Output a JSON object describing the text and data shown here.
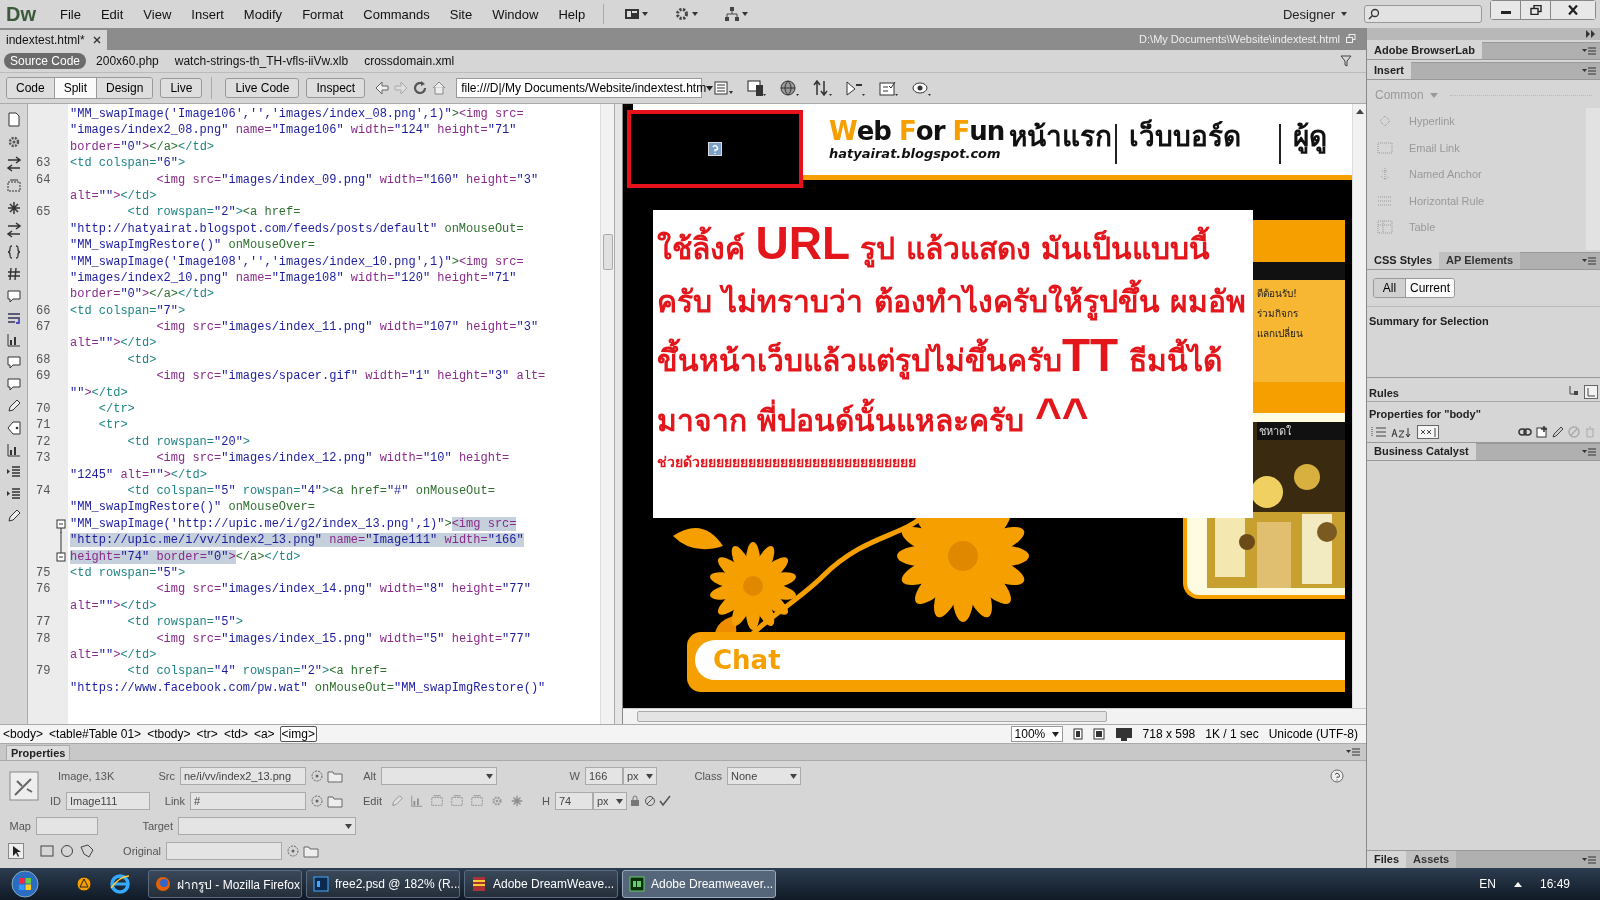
{
  "app": {
    "logo": "Dw",
    "menus": [
      "File",
      "Edit",
      "View",
      "Insert",
      "Modify",
      "Format",
      "Commands",
      "Site",
      "Window",
      "Help"
    ],
    "workspace": "Designer"
  },
  "document_tabs": [
    {
      "label": "indextest.html*",
      "selected": true
    }
  ],
  "document_path": "D:\\My Documents\\Website\\indextest.html",
  "related_files": [
    {
      "label": "Source Code",
      "selected": true
    },
    {
      "label": "200x60.php",
      "selected": false
    },
    {
      "label": "watch-strings-th_TH-vfls-iiVw.xlb",
      "selected": false
    },
    {
      "label": "crossdomain.xml",
      "selected": false
    }
  ],
  "toolbar": {
    "view_buttons": [
      {
        "label": "Code",
        "selected": false
      },
      {
        "label": "Split",
        "selected": true
      },
      {
        "label": "Design",
        "selected": false
      },
      {
        "label": "Live",
        "selected": false
      }
    ],
    "live_buttons": [
      "Live Code",
      "Inspect"
    ],
    "address": "file:///D|/My Documents/Website/indextest.htm"
  },
  "code_lines": [
    {
      "text": "\"MM_swapImage('Image106','','images/index_08.png',1)\"><img src="
    },
    {
      "text": "\"images/index2_08.png\" name=\"Image106\" width=\"124\" height=\"71\""
    },
    {
      "text": "border=\"0\"></a></td>"
    },
    {
      "number": "63",
      "text": "<td colspan=\"6\">"
    },
    {
      "number": "64",
      "text": "            <img src=\"images/index_09.png\" width=\"160\" height=\"3\""
    },
    {
      "text": "alt=\"\"></td>"
    },
    {
      "number": "65",
      "text": "        <td rowspan=\"2\"><a href="
    },
    {
      "text": "\"http://hatyairat.blogspot.com/feeds/posts/default\" onMouseOut="
    },
    {
      "text": "\"MM_swapImgRestore()\" onMouseOver="
    },
    {
      "text": "\"MM_swapImage('Image108','','images/index_10.png',1)\"><img src="
    },
    {
      "text": "\"images/index2_10.png\" name=\"Image108\" width=\"120\" height=\"71\""
    },
    {
      "text": "border=\"0\"></a></td>"
    },
    {
      "number": "66",
      "text": "<td colspan=\"7\">"
    },
    {
      "number": "67",
      "text": "            <img src=\"images/index_11.png\" width=\"107\" height=\"3\""
    },
    {
      "text": "alt=\"\"></td>"
    },
    {
      "number": "68",
      "text": "        <td>"
    },
    {
      "number": "69",
      "text": "            <img src=\"images/spacer.gif\" width=\"1\" height=\"3\" alt="
    },
    {
      "text": "\"\"></td>"
    },
    {
      "number": "70",
      "text": "    </tr>"
    },
    {
      "number": "71",
      "text": "    <tr>"
    },
    {
      "number": "72",
      "text": "        <td rowspan=\"20\">"
    },
    {
      "number": "73",
      "text": "            <img src=\"images/index_12.png\" width=\"10\" height="
    },
    {
      "text": "\"1245\" alt=\"\"></td>"
    },
    {
      "number": "74",
      "text": "        <td colspan=\"5\" rowspan=\"4\"><a href=\"#\" onMouseOut="
    },
    {
      "text": "\"MM_swapImgRestore()\" onMouseOver="
    },
    {
      "kind": "fold-start",
      "parts": [
        {
          "text": "\"MM_swapImage('http://upic.me/i/g2/index_13.png',1)\">",
          "selected": false
        },
        {
          "text": "<img src=",
          "selected": true
        }
      ]
    },
    {
      "kind": "fold-middle",
      "parts": [
        {
          "text": "\"http://upic.me/i/vv/index2_13.png\" name=\"Image111\" width=\"166\"",
          "selected": true
        }
      ]
    },
    {
      "kind": "fold-end",
      "parts": [
        {
          "text": "height=\"74\" border=\"0\">",
          "selected": true
        },
        {
          "text": "</a></td>",
          "selected": false
        }
      ]
    },
    {
      "number": "75",
      "text": "<td rowspan=\"5\">"
    },
    {
      "number": "76",
      "text": "            <img src=\"images/index_14.png\" width=\"8\" height=\"77\""
    },
    {
      "text": "alt=\"\"></td>"
    },
    {
      "number": "77",
      "text": "        <td rowspan=\"5\">"
    },
    {
      "number": "78",
      "text": "            <img src=\"images/index_15.png\" width=\"5\" height=\"77\""
    },
    {
      "text": "alt=\"\"></td>"
    },
    {
      "number": "79",
      "text": "        <td colspan=\"4\" rowspan=\"2\"><a href="
    },
    {
      "text": "\"https://www.facebook.com/pw.wat\" onMouseOut=\"MM_swapImgRestore()\""
    }
  ],
  "design_view": {
    "logo_title": "Web For Fun",
    "logo_url": "hatyairat.blogspot.com",
    "nav_items": [
      "หน้าแรก",
      "เว็บบอร์ด",
      "ผู้ดู"
    ],
    "message": "ใช้ลิ้งค์ **URL** รูป แล้วแสดง มันเป็นแบบนี้ครับ ไม่ทราบว่า ต้องทำไงครับให้รูปขึ้น ผมอัพขึ้นหน้าเว็บแล้วแต่รูปไม่ขึ้นครับ**TT** ธีมนี้ได้ มาจาก พี่ปอนด์นั้นแหละครับ **^^**",
    "message_note": "ช่วยด้วยยยยยยยยยยยยยยยยยยยยยยยยยยย",
    "side_texts": [
      "ดีต้อนรับ!",
      "ร่วมกิจกร",
      "แลกเปลี่ยน"
    ],
    "photo_caption": "ชหาดใ",
    "chat_title": "Chat"
  },
  "status_bar": {
    "tags": [
      {
        "label": "<body>",
        "selected": false
      },
      {
        "label": "<table#Table 01>",
        "selected": false
      },
      {
        "label": "<tbody>",
        "selected": false
      },
      {
        "label": "<tr>",
        "selected": false
      },
      {
        "label": "<td>",
        "selected": false
      },
      {
        "label": "<a>",
        "selected": false
      },
      {
        "label": "<img>",
        "selected": true
      }
    ],
    "zoom": "100%",
    "size": "718 x 598",
    "download": "1K / 1 sec",
    "encoding": "Unicode (UTF-8)"
  },
  "properties": {
    "title": "Properties",
    "type_label": "Image, 13K",
    "id_label": "ID",
    "id_value": "Image111",
    "src_label": "Src",
    "src_value": "ne/i/vv/index2_13.png",
    "link_label": "Link",
    "link_value": "#",
    "alt_label": "Alt",
    "edit_label": "Edit",
    "w_label": "W",
    "w_value": "166",
    "w_unit": "px",
    "h_label": "H",
    "h_value": "74",
    "h_unit": "px",
    "class_label": "Class",
    "class_value": "None",
    "map_label": "Map",
    "target_label": "Target",
    "original_label": "Original"
  },
  "panels": {
    "browserlab": "Adobe BrowserLab",
    "insert_tab": "Insert",
    "insert_category": "Common",
    "insert_items": [
      {
        "label": "Hyperlink",
        "disabled": true
      },
      {
        "label": "Email Link",
        "disabled": true
      },
      {
        "label": "Named Anchor",
        "disabled": true
      },
      {
        "label": "Horizontal Rule",
        "disabled": true
      },
      {
        "label": "Table",
        "disabled": true
      }
    ],
    "css_tabs": [
      {
        "label": "CSS Styles",
        "selected": true
      },
      {
        "label": "AP Elements",
        "selected": false
      }
    ],
    "css_modes": [
      {
        "label": "All",
        "selected": false
      },
      {
        "label": "Current",
        "selected": true
      }
    ],
    "summary_title": "Summary for Selection",
    "rules_title": "Rules",
    "properties_title": "Properties for \"body\"",
    "business_catalyst": "Business Catalyst",
    "bottom_tabs": [
      {
        "label": "Files",
        "selected": true
      },
      {
        "label": "Assets",
        "selected": false
      }
    ]
  },
  "taskbar": {
    "tasks": [
      {
        "label": "ฝากรูป - Mozilla Firefox",
        "selected": false
      },
      {
        "label": "free2.psd @ 182% (R...",
        "selected": false
      },
      {
        "label": "Adobe DreamWeave...",
        "selected": false
      },
      {
        "label": "Adobe Dreamweaver...",
        "selected": true
      }
    ],
    "language": "EN",
    "clock": "16:49"
  }
}
